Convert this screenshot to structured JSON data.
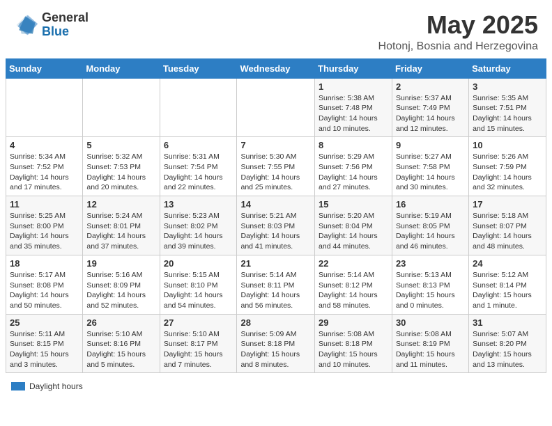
{
  "header": {
    "logo_general": "General",
    "logo_blue": "Blue",
    "month_title": "May 2025",
    "location": "Hotonj, Bosnia and Herzegovina"
  },
  "days_of_week": [
    "Sunday",
    "Monday",
    "Tuesday",
    "Wednesday",
    "Thursday",
    "Friday",
    "Saturday"
  ],
  "weeks": [
    [
      {
        "day": "",
        "info": ""
      },
      {
        "day": "",
        "info": ""
      },
      {
        "day": "",
        "info": ""
      },
      {
        "day": "",
        "info": ""
      },
      {
        "day": "1",
        "info": "Sunrise: 5:38 AM\nSunset: 7:48 PM\nDaylight: 14 hours\nand 10 minutes."
      },
      {
        "day": "2",
        "info": "Sunrise: 5:37 AM\nSunset: 7:49 PM\nDaylight: 14 hours\nand 12 minutes."
      },
      {
        "day": "3",
        "info": "Sunrise: 5:35 AM\nSunset: 7:51 PM\nDaylight: 14 hours\nand 15 minutes."
      }
    ],
    [
      {
        "day": "4",
        "info": "Sunrise: 5:34 AM\nSunset: 7:52 PM\nDaylight: 14 hours\nand 17 minutes."
      },
      {
        "day": "5",
        "info": "Sunrise: 5:32 AM\nSunset: 7:53 PM\nDaylight: 14 hours\nand 20 minutes."
      },
      {
        "day": "6",
        "info": "Sunrise: 5:31 AM\nSunset: 7:54 PM\nDaylight: 14 hours\nand 22 minutes."
      },
      {
        "day": "7",
        "info": "Sunrise: 5:30 AM\nSunset: 7:55 PM\nDaylight: 14 hours\nand 25 minutes."
      },
      {
        "day": "8",
        "info": "Sunrise: 5:29 AM\nSunset: 7:56 PM\nDaylight: 14 hours\nand 27 minutes."
      },
      {
        "day": "9",
        "info": "Sunrise: 5:27 AM\nSunset: 7:58 PM\nDaylight: 14 hours\nand 30 minutes."
      },
      {
        "day": "10",
        "info": "Sunrise: 5:26 AM\nSunset: 7:59 PM\nDaylight: 14 hours\nand 32 minutes."
      }
    ],
    [
      {
        "day": "11",
        "info": "Sunrise: 5:25 AM\nSunset: 8:00 PM\nDaylight: 14 hours\nand 35 minutes."
      },
      {
        "day": "12",
        "info": "Sunrise: 5:24 AM\nSunset: 8:01 PM\nDaylight: 14 hours\nand 37 minutes."
      },
      {
        "day": "13",
        "info": "Sunrise: 5:23 AM\nSunset: 8:02 PM\nDaylight: 14 hours\nand 39 minutes."
      },
      {
        "day": "14",
        "info": "Sunrise: 5:21 AM\nSunset: 8:03 PM\nDaylight: 14 hours\nand 41 minutes."
      },
      {
        "day": "15",
        "info": "Sunrise: 5:20 AM\nSunset: 8:04 PM\nDaylight: 14 hours\nand 44 minutes."
      },
      {
        "day": "16",
        "info": "Sunrise: 5:19 AM\nSunset: 8:05 PM\nDaylight: 14 hours\nand 46 minutes."
      },
      {
        "day": "17",
        "info": "Sunrise: 5:18 AM\nSunset: 8:07 PM\nDaylight: 14 hours\nand 48 minutes."
      }
    ],
    [
      {
        "day": "18",
        "info": "Sunrise: 5:17 AM\nSunset: 8:08 PM\nDaylight: 14 hours\nand 50 minutes."
      },
      {
        "day": "19",
        "info": "Sunrise: 5:16 AM\nSunset: 8:09 PM\nDaylight: 14 hours\nand 52 minutes."
      },
      {
        "day": "20",
        "info": "Sunrise: 5:15 AM\nSunset: 8:10 PM\nDaylight: 14 hours\nand 54 minutes."
      },
      {
        "day": "21",
        "info": "Sunrise: 5:14 AM\nSunset: 8:11 PM\nDaylight: 14 hours\nand 56 minutes."
      },
      {
        "day": "22",
        "info": "Sunrise: 5:14 AM\nSunset: 8:12 PM\nDaylight: 14 hours\nand 58 minutes."
      },
      {
        "day": "23",
        "info": "Sunrise: 5:13 AM\nSunset: 8:13 PM\nDaylight: 15 hours\nand 0 minutes."
      },
      {
        "day": "24",
        "info": "Sunrise: 5:12 AM\nSunset: 8:14 PM\nDaylight: 15 hours\nand 1 minute."
      }
    ],
    [
      {
        "day": "25",
        "info": "Sunrise: 5:11 AM\nSunset: 8:15 PM\nDaylight: 15 hours\nand 3 minutes."
      },
      {
        "day": "26",
        "info": "Sunrise: 5:10 AM\nSunset: 8:16 PM\nDaylight: 15 hours\nand 5 minutes."
      },
      {
        "day": "27",
        "info": "Sunrise: 5:10 AM\nSunset: 8:17 PM\nDaylight: 15 hours\nand 7 minutes."
      },
      {
        "day": "28",
        "info": "Sunrise: 5:09 AM\nSunset: 8:18 PM\nDaylight: 15 hours\nand 8 minutes."
      },
      {
        "day": "29",
        "info": "Sunrise: 5:08 AM\nSunset: 8:18 PM\nDaylight: 15 hours\nand 10 minutes."
      },
      {
        "day": "30",
        "info": "Sunrise: 5:08 AM\nSunset: 8:19 PM\nDaylight: 15 hours\nand 11 minutes."
      },
      {
        "day": "31",
        "info": "Sunrise: 5:07 AM\nSunset: 8:20 PM\nDaylight: 15 hours\nand 13 minutes."
      }
    ]
  ],
  "footer": {
    "label": "Daylight hours"
  }
}
